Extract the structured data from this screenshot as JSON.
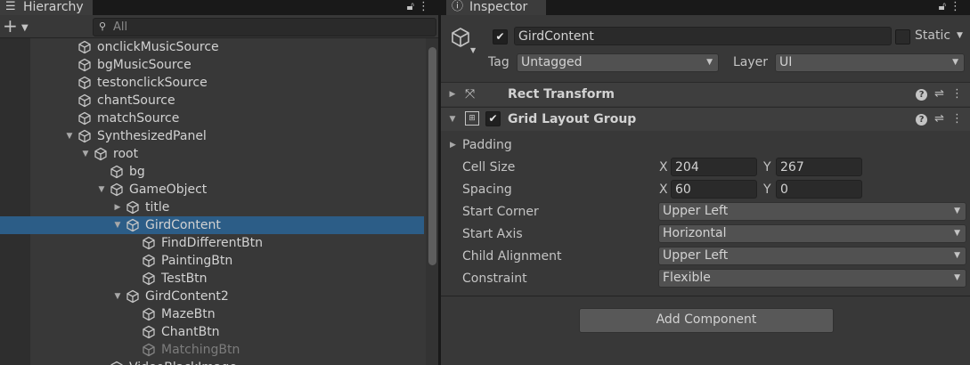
{
  "hierarchy": {
    "tab_label": "Hierarchy",
    "search_placeholder": "All",
    "items": [
      {
        "label": "onclickMusicSource",
        "depth": 0
      },
      {
        "label": "bgMusicSource",
        "depth": 0
      },
      {
        "label": "testonclickSource",
        "depth": 0
      },
      {
        "label": "chantSource",
        "depth": 0
      },
      {
        "label": "matchSource",
        "depth": 0
      },
      {
        "label": "SynthesizedPanel",
        "depth": 0,
        "expanded": true
      },
      {
        "label": "root",
        "depth": 1,
        "expanded": true
      },
      {
        "label": "bg",
        "depth": 2
      },
      {
        "label": "GameObject",
        "depth": 2,
        "expanded": true
      },
      {
        "label": "title",
        "depth": 3,
        "collapsed": true
      },
      {
        "label": "GirdContent",
        "depth": 3,
        "expanded": true,
        "selected": true
      },
      {
        "label": "FindDifferentBtn",
        "depth": 4
      },
      {
        "label": "PaintingBtn",
        "depth": 4
      },
      {
        "label": "TestBtn",
        "depth": 4
      },
      {
        "label": "GirdContent2",
        "depth": 3,
        "expanded": true
      },
      {
        "label": "MazeBtn",
        "depth": 4
      },
      {
        "label": "ChantBtn",
        "depth": 4
      },
      {
        "label": "MatchingBtn",
        "depth": 4,
        "inactive": true
      },
      {
        "label": "VideoBlackImage",
        "depth": 2
      }
    ]
  },
  "inspector": {
    "tab_label": "Inspector",
    "object_name": "GirdContent",
    "static_label": "Static",
    "tag_label": "Tag",
    "tag_value": "Untagged",
    "layer_label": "Layer",
    "layer_value": "UI",
    "components": [
      {
        "title": "Rect Transform",
        "expanded": false
      },
      {
        "title": "Grid Layout Group",
        "expanded": true
      }
    ],
    "grid": {
      "padding_label": "Padding",
      "cell_size_label": "Cell Size",
      "cell_x": "204",
      "cell_y": "267",
      "spacing_label": "Spacing",
      "spacing_x": "60",
      "spacing_y": "0",
      "x_label": "X",
      "y_label": "Y",
      "start_corner_label": "Start Corner",
      "start_corner_value": "Upper Left",
      "start_axis_label": "Start Axis",
      "start_axis_value": "Horizontal",
      "child_alignment_label": "Child Alignment",
      "child_alignment_value": "Upper Left",
      "constraint_label": "Constraint",
      "constraint_value": "Flexible"
    },
    "add_component_label": "Add Component"
  },
  "colors": {
    "selection": "#2c5d87",
    "panel": "#383838",
    "tabbar": "#191919"
  }
}
